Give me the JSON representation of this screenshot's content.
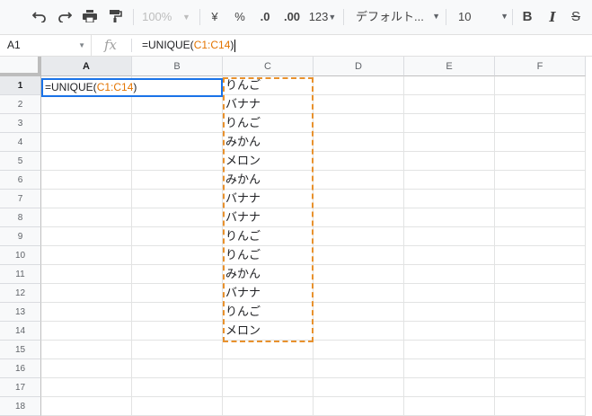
{
  "toolbar": {
    "zoom": "100%",
    "currency": "¥",
    "percent": "%",
    "dec_decrease": ".0",
    "dec_increase": ".00",
    "number_format": "123",
    "font": "デフォルト...",
    "font_size": "10",
    "bold": "B",
    "italic": "I",
    "strike": "S"
  },
  "formula_bar": {
    "cell_ref": "A1",
    "fx": "fx",
    "formula_prefix": "=UNIQUE(",
    "formula_range": "C1:C14",
    "formula_suffix": ")"
  },
  "columns": [
    "A",
    "B",
    "C",
    "D",
    "E",
    "F"
  ],
  "rows": [
    "1",
    "2",
    "3",
    "4",
    "5",
    "6",
    "7",
    "8",
    "9",
    "10",
    "11",
    "12",
    "13",
    "14",
    "15",
    "16",
    "17",
    "18"
  ],
  "active_cell": {
    "prefix": "=UNIQUE(",
    "range": "C1:C14",
    "suffix": ")"
  },
  "column_c": [
    "りんご",
    "バナナ",
    "りんご",
    "みかん",
    "メロン",
    "みかん",
    "バナナ",
    "バナナ",
    "りんご",
    "りんご",
    "みかん",
    "バナナ",
    "りんご",
    "メロン"
  ],
  "colors": {
    "selection": "#1a73e8",
    "range_highlight": "#e8912d"
  }
}
